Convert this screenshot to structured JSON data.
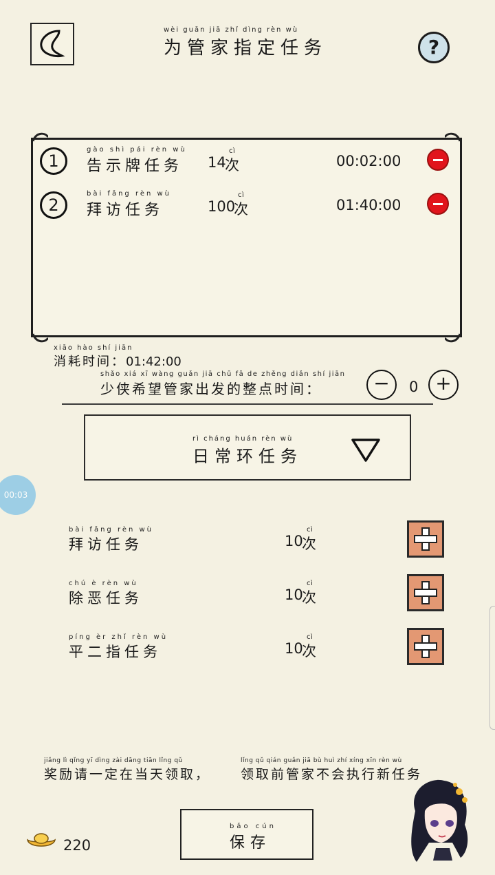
{
  "header": {
    "title_pinyin": "wèi guǎn jiā zhǐ dìng rèn wù",
    "title": "为管家指定任务",
    "help_label": "?"
  },
  "assigned_tasks": [
    {
      "index": "1",
      "name_pinyin": "gào shì pái rèn wù",
      "name": "告示牌任务",
      "count": "14",
      "unit_pinyin": "cì",
      "unit": "次",
      "time": "00:02:00"
    },
    {
      "index": "2",
      "name_pinyin": "bài fǎng rèn wù",
      "name": "拜访任务",
      "count": "100",
      "unit_pinyin": "cì",
      "unit": "次",
      "time": "01:40:00"
    }
  ],
  "consume": {
    "label_pinyin": "xiāo hào shí jiān",
    "label": "消耗时间：",
    "value": "01:42:00"
  },
  "depart": {
    "label_pinyin": "shǎo xiá xī wàng guǎn jiā chū fā de zhěng diǎn shí jiān",
    "label": "少侠希望管家出发的整点时间：",
    "minus_label": "−",
    "value": "0",
    "plus_label": "+"
  },
  "dropdown": {
    "pinyin": "rì cháng huán rèn wù",
    "selected": "日常环任务"
  },
  "available_tasks": [
    {
      "name_pinyin": "bài fǎng rèn wù",
      "name": "拜访任务",
      "count": "10",
      "unit_pinyin": "cì",
      "unit": "次"
    },
    {
      "name_pinyin": "chú è rèn wù",
      "name": "除恶任务",
      "count": "10",
      "unit_pinyin": "cì",
      "unit": "次"
    },
    {
      "name_pinyin": "píng èr zhǐ rèn wù",
      "name": "平二指任务",
      "count": "10",
      "unit_pinyin": "cì",
      "unit": "次"
    }
  ],
  "notice": {
    "pinyin_1": "jiǎng lì qǐng yī dìng zài dāng tiān lǐng qǔ",
    "pinyin_2": "lǐng qǔ qián guǎn jiā bù huì zhí xíng xīn rèn wù",
    "text_1": "奖励请一定在当天领取，",
    "text_2": "领取前管家不会执行新任务"
  },
  "save": {
    "pinyin": "bǎo cún",
    "label": "保存"
  },
  "currency": {
    "amount": "220"
  },
  "timer_bubble": "00:03",
  "colors": {
    "background": "#f4f1e2",
    "remove_red": "#e1141c",
    "add_orange": "#e39873",
    "help_blue": "#cfe2ea",
    "bubble_blue": "#8ec9e6"
  }
}
